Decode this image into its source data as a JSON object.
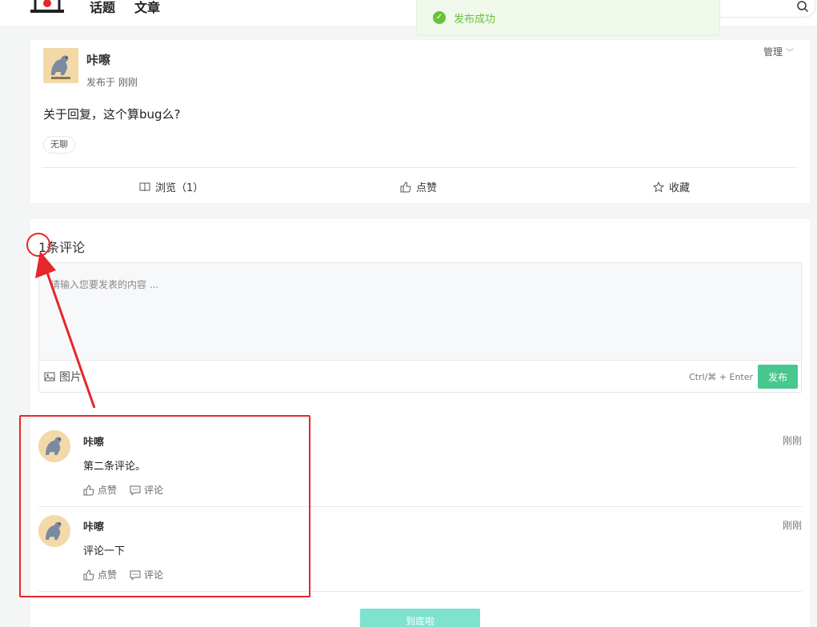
{
  "nav": {
    "items": [
      "话题",
      "文章"
    ]
  },
  "toast": {
    "text": "发布成功"
  },
  "post": {
    "author": "咔嚓",
    "time": "发布于 刚刚",
    "manage_label": "管理",
    "content": "关于回复，这个算bug么?",
    "tag": "无聊",
    "views_label": "浏览（1）",
    "like_label": "点赞",
    "favorite_label": "收藏"
  },
  "comments": {
    "count_label": "1条评论",
    "input_placeholder": "请输入您要发表的内容 ...",
    "image_label": "图片",
    "shortcut_hint": "Ctrl/⌘ + Enter",
    "publish_label": "发布",
    "items": [
      {
        "author": "咔嚓",
        "time": "刚刚",
        "text": "第二条评论。",
        "like_label": "点赞",
        "reply_label": "评论"
      },
      {
        "author": "咔嚓",
        "time": "刚刚",
        "text": "评论一下",
        "like_label": "点赞",
        "reply_label": "评论"
      }
    ],
    "bottom_label": "到底啦"
  },
  "colors": {
    "accent": "#48c78e",
    "annotation": "#e5262a",
    "toast_success": "#67c23a"
  }
}
